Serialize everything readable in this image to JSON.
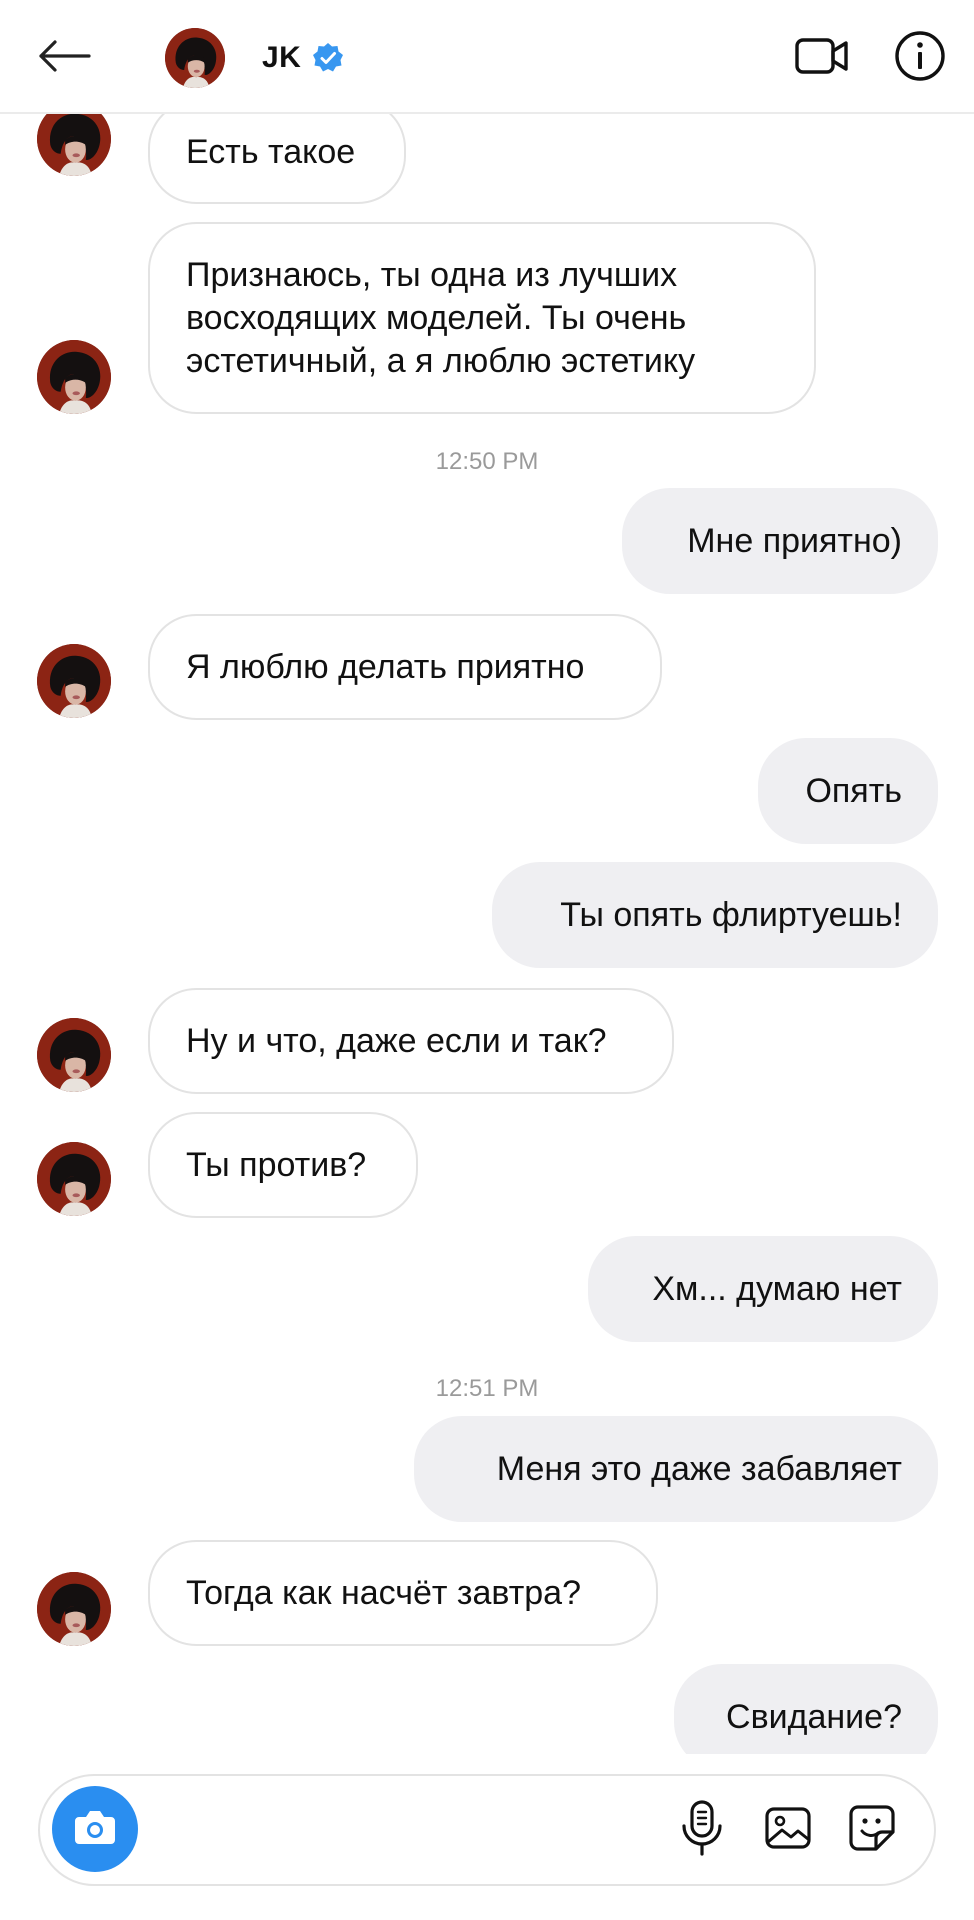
{
  "header": {
    "back_icon": "arrow-left-icon",
    "contact_name": "JK",
    "verified_icon": "verified-badge-icon",
    "video_icon": "video-camera-icon",
    "info_icon": "info-icon"
  },
  "colors": {
    "accent": "#2a8ef0",
    "verified": "#3897f0",
    "incoming_bubble_border": "#e3e3e3",
    "outgoing_bubble_bg": "#efeff2",
    "timestamp": "#9a9a9a"
  },
  "messages": {
    "m1": "Есть такое",
    "m2": "Признаюсь, ты одна из лучших восходящих моделей. Ты очень эстетичный, а я люблю эстетику",
    "t1": "12:50 PM",
    "m3": "Мне приятно)",
    "m4": "Я люблю делать приятно",
    "m5": "Опять",
    "m6": "Ты опять флиртуешь!",
    "m7": "Ну и что, даже если и так?",
    "m8": "Ты против?",
    "m9": "Хм... думаю нет",
    "t2": "12:51 PM",
    "m10": "Меня это даже забавляет",
    "m11": "Тогда как насчёт завтра?",
    "m12": "Свидание?"
  },
  "composer": {
    "camera_icon": "camera-icon",
    "mic_icon": "microphone-icon",
    "gallery_icon": "gallery-icon",
    "sticker_icon": "sticker-icon"
  }
}
